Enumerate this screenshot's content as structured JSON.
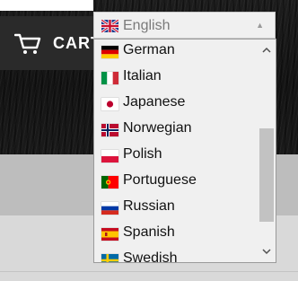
{
  "header": {
    "cart_label": "CART"
  },
  "language_select": {
    "selected": {
      "label": "English",
      "flag": "uk-flag-icon"
    },
    "options": [
      {
        "label": "German",
        "flag": "germany-flag-icon"
      },
      {
        "label": "Italian",
        "flag": "italy-flag-icon"
      },
      {
        "label": "Japanese",
        "flag": "japan-flag-icon"
      },
      {
        "label": "Norwegian",
        "flag": "norway-flag-icon"
      },
      {
        "label": "Polish",
        "flag": "poland-flag-icon"
      },
      {
        "label": "Portuguese",
        "flag": "portugal-flag-icon"
      },
      {
        "label": "Russian",
        "flag": "russia-flag-icon"
      },
      {
        "label": "Spanish",
        "flag": "spain-flag-icon"
      },
      {
        "label": "Swedish",
        "flag": "sweden-flag-icon"
      }
    ]
  },
  "colors": {
    "header_bg": "#1a1a1a",
    "dropdown_bg": "#f0f0f0",
    "scroll_thumb": "#c2c2c2"
  }
}
